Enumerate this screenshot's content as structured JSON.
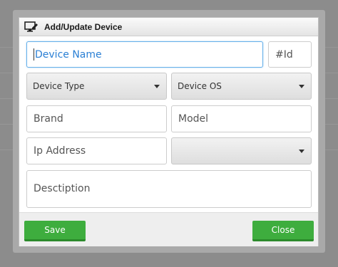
{
  "dialog": {
    "title": "Add/Update Device",
    "title_icon": "monitor-edit-icon"
  },
  "form": {
    "device_name": {
      "value": "",
      "placeholder": "Device Name"
    },
    "device_id": {
      "value": "",
      "placeholder": "#Id"
    },
    "device_type": {
      "selected": "Device Type"
    },
    "device_os": {
      "selected": "Device OS"
    },
    "brand": {
      "value": "",
      "placeholder": "Brand"
    },
    "model": {
      "value": "",
      "placeholder": "Model"
    },
    "ip_address": {
      "value": "",
      "placeholder": "Ip Address"
    },
    "ip_select": {
      "selected": ""
    },
    "description": {
      "value": "",
      "placeholder": "Desctiption"
    }
  },
  "buttons": {
    "save": "Save",
    "close": "Close"
  },
  "colors": {
    "button_green": "#3ead3e",
    "focus_blue": "#66afe9"
  }
}
